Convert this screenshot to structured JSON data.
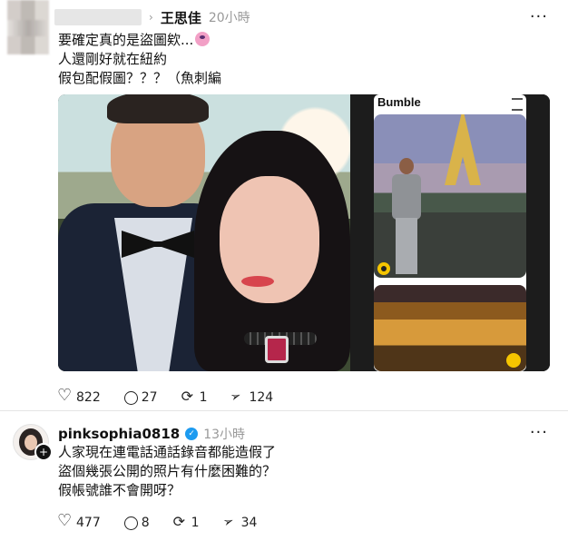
{
  "post1": {
    "username": "王思佳",
    "time": "20小時",
    "more": "···",
    "lines": [
      "要確定真的是盜圖欸...",
      "人還剛好就在紐約",
      "假包配假圖？？？（魚刺編"
    ],
    "media": {
      "bumble_label": "Bumble"
    },
    "actions": {
      "likes": "822",
      "comments": "27",
      "reposts": "1",
      "shares": "124"
    }
  },
  "post2": {
    "username": "pinksophia0818",
    "time": "13小時",
    "more": "···",
    "lines": [
      "人家現在連電話通話錄音都能造假了",
      "盜個幾張公開的照片有什麼困難的？",
      "假帳號誰不會開呀？"
    ],
    "actions": {
      "likes": "477",
      "comments": "8",
      "reposts": "1",
      "shares": "34"
    }
  },
  "icons": [
    "heart-icon",
    "comment-icon",
    "repost-icon",
    "share-icon",
    "verified-icon",
    "more-icon",
    "plus-icon"
  ]
}
